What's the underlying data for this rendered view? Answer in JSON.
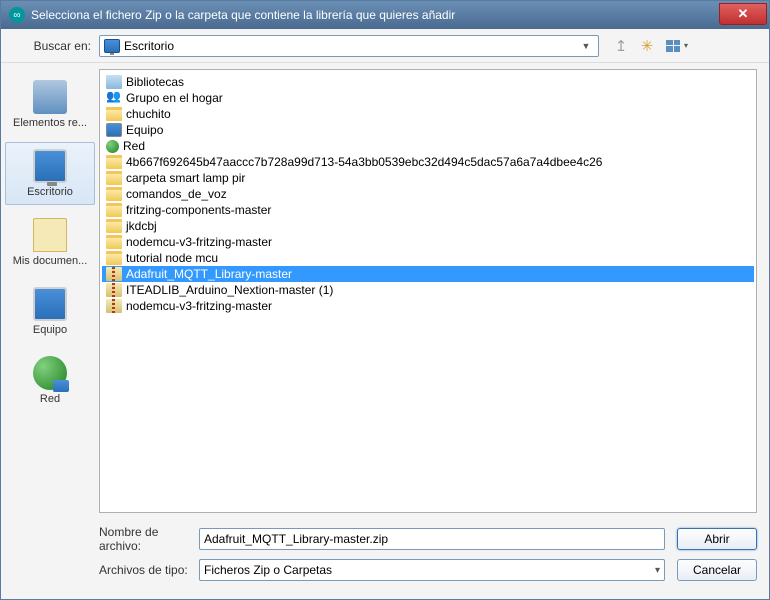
{
  "titlebar": {
    "title": "Selecciona el fichero Zip o la carpeta que contiene la librería que quieres añadir"
  },
  "toolbar": {
    "lookin_label": "Buscar en:",
    "lookin_value": "Escritorio"
  },
  "sidebar": {
    "items": [
      {
        "label": "Elementos re..."
      },
      {
        "label": "Escritorio"
      },
      {
        "label": "Mis documen..."
      },
      {
        "label": "Equipo"
      },
      {
        "label": "Red"
      }
    ]
  },
  "files": {
    "items": [
      {
        "icon": "libfolder",
        "name": "Bibliotecas"
      },
      {
        "icon": "group",
        "name": "Grupo en el hogar"
      },
      {
        "icon": "folder",
        "name": "chuchito"
      },
      {
        "icon": "computer",
        "name": "Equipo"
      },
      {
        "icon": "network",
        "name": "Red"
      },
      {
        "icon": "folder",
        "name": "4b667f692645b47aaccc7b728a99d713-54a3bb0539ebc32d494c5dac57a6a7a4dbee4c26"
      },
      {
        "icon": "folder",
        "name": "carpeta smart lamp pir"
      },
      {
        "icon": "folder",
        "name": "comandos_de_voz"
      },
      {
        "icon": "folder",
        "name": "fritzing-components-master"
      },
      {
        "icon": "folder",
        "name": "jkdcbj"
      },
      {
        "icon": "folder",
        "name": "nodemcu-v3-fritzing-master"
      },
      {
        "icon": "folder",
        "name": "tutorial node mcu"
      },
      {
        "icon": "zip",
        "name": "Adafruit_MQTT_Library-master",
        "selected": true
      },
      {
        "icon": "zip",
        "name": "ITEADLIB_Arduino_Nextion-master (1)"
      },
      {
        "icon": "zip",
        "name": "nodemcu-v3-fritzing-master"
      }
    ]
  },
  "footer": {
    "filename_label": "Nombre de archivo:",
    "filename_value": "Adafruit_MQTT_Library-master.zip",
    "filetype_label": "Archivos de tipo:",
    "filetype_value": "Ficheros Zip o Carpetas",
    "open_label": "Abrir",
    "cancel_label": "Cancelar"
  }
}
